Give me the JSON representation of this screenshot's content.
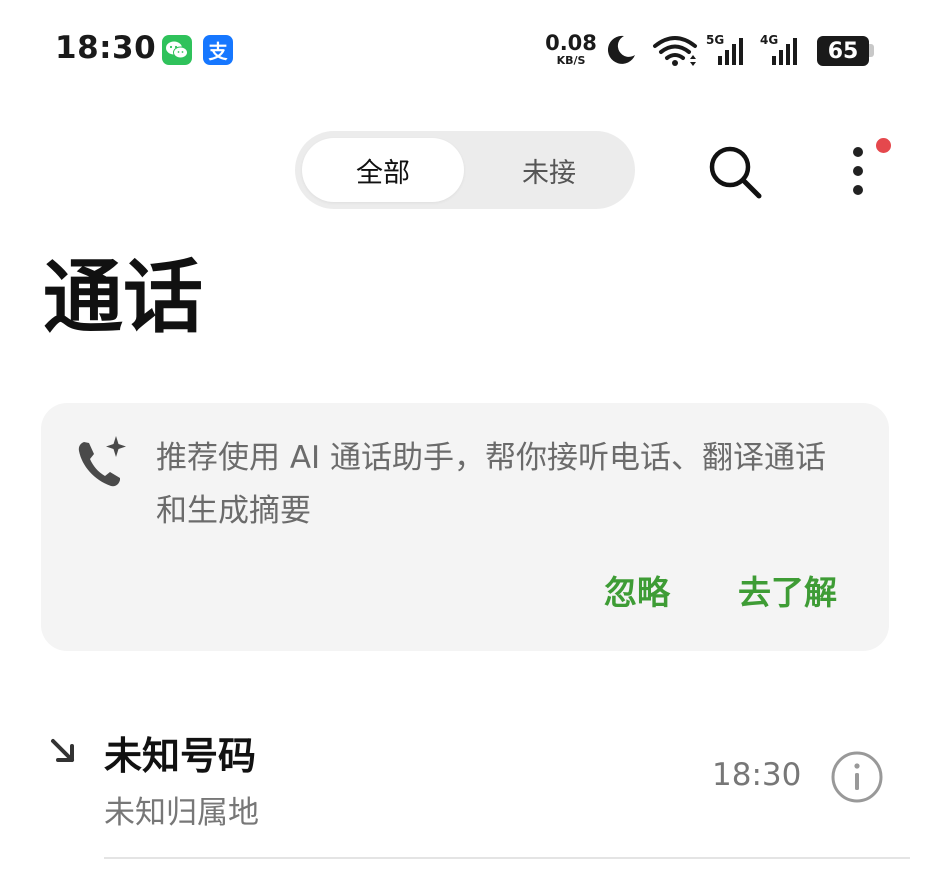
{
  "status_bar": {
    "time": "18:30",
    "apps": [
      "wechat-icon",
      "alipay-icon"
    ],
    "alipay_glyph": "支",
    "net_speed_value": "0.08",
    "net_speed_unit": "KB/S",
    "signal_1": "5G",
    "signal_2": "4G",
    "battery": "65"
  },
  "tabs": {
    "all": "全部",
    "missed": "未接"
  },
  "page_title": "通话",
  "ai_card": {
    "text": "推荐使用 AI 通话助手，帮你接听电话、翻译通话和生成摘要",
    "ignore": "忽略",
    "learn_more": "去了解",
    "accent_color": "#3e9c35"
  },
  "calls": [
    {
      "name": "未知号码",
      "location": "未知归属地",
      "time": "18:30",
      "direction": "incoming"
    }
  ]
}
